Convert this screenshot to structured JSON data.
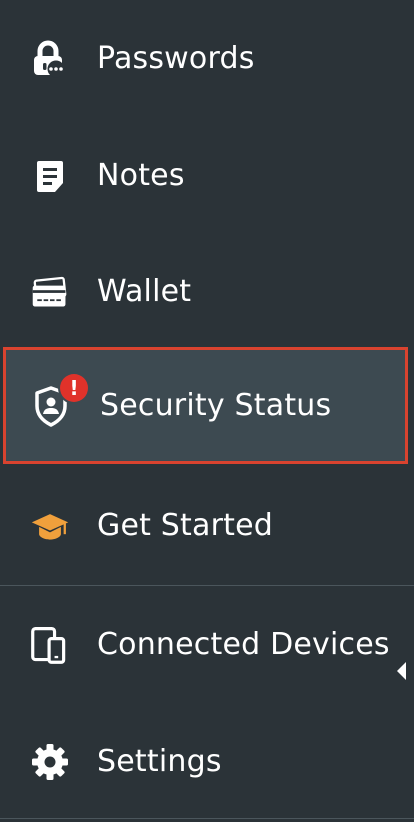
{
  "sidebar": {
    "items": [
      {
        "label": "Passwords",
        "icon": "lock-icon"
      },
      {
        "label": "Notes",
        "icon": "note-icon"
      },
      {
        "label": "Wallet",
        "icon": "wallet-cards-icon"
      },
      {
        "label": "Security Status",
        "icon": "shield-user-icon",
        "badge": "!"
      },
      {
        "label": "Get Started",
        "icon": "graduation-cap-icon"
      },
      {
        "label": "Connected Devices",
        "icon": "devices-icon"
      },
      {
        "label": "Settings",
        "icon": "gear-icon"
      }
    ]
  },
  "colors": {
    "background": "#2b3338",
    "selected_background": "#3d4a51",
    "selected_border": "#d9432f",
    "badge": "#e0322a",
    "graduation_cap": "#f0a03c"
  }
}
